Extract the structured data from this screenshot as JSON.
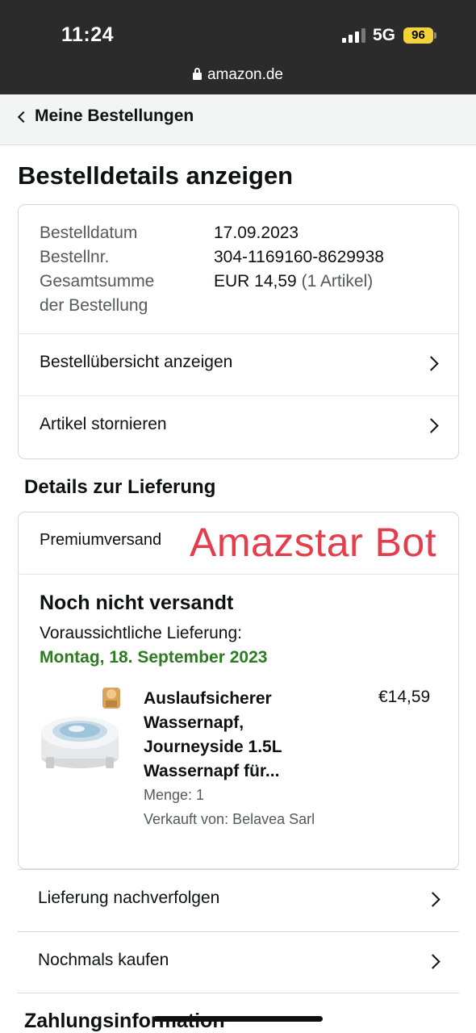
{
  "statusbar": {
    "time": "11:24",
    "network": "5G",
    "battery": "96",
    "url": "amazon.de"
  },
  "nav": {
    "back_label": "Meine Bestellungen"
  },
  "page": {
    "title": "Bestelldetails anzeigen"
  },
  "order": {
    "date_label": "Bestelldatum",
    "date_value": "17.09.2023",
    "number_label": "Bestellnr.",
    "number_value": "304-1169160-8629938",
    "total_label_line1": "Gesamtsumme",
    "total_label_line2": "der Bestellung",
    "total_value": "EUR 14,59",
    "total_items": "(1 Artikel)",
    "actions": [
      {
        "label": "Bestellübersicht anzeigen"
      },
      {
        "label": "Artikel stornieren"
      }
    ]
  },
  "delivery": {
    "section_title": "Details zur Lieferung",
    "shipping_type": "Premiumversand",
    "watermark": "Amazstar Bot",
    "status": "Noch nicht versandt",
    "expected_label": "Voraussichtliche Lieferung:",
    "expected_date": "Montag, 18. September 2023",
    "item": {
      "name_lines": [
        "Auslaufsicherer",
        "Wassernapf,",
        "Journeyside 1.5L",
        "Wassernapf für..."
      ],
      "price": "€14,59",
      "quantity": "Menge: 1",
      "seller": "Verkauft von: Belavea Sarl"
    }
  },
  "list_actions": [
    {
      "label": "Lieferung nachverfolgen"
    },
    {
      "label": "Nochmals kaufen"
    }
  ],
  "payment": {
    "section_title": "Zahlungsinformation"
  },
  "colors": {
    "status_bar": "#2b2b2b",
    "green_date": "#2d7a23",
    "watermark": "#e43d4b",
    "battery": "#f2d43a"
  }
}
